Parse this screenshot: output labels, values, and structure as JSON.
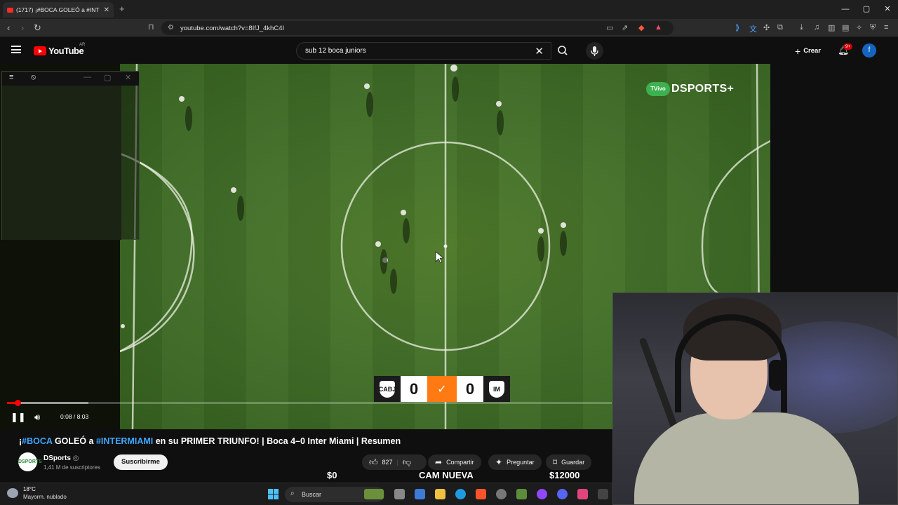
{
  "browser": {
    "tab_title": "(1717) ¡#BOCA GOLEÓ a #INT",
    "tab_close": "✕",
    "new_tab": "+",
    "url": "youtube.com/watch?v=8IfJ_4khC4I",
    "window_controls": [
      "—",
      "▢",
      "✕"
    ]
  },
  "youtube": {
    "logo_text": "YouTube",
    "country_code": "AR",
    "search_query": "sub 12 boca juniors",
    "clear_search": "✕",
    "create_label": "Crear",
    "notifications_badge": "9+",
    "account_initial": "f"
  },
  "video": {
    "broadcaster": "DSPORTS+",
    "live_badge": "TVivo",
    "score_home": "0",
    "score_away": "0",
    "home_crest": "CABJ",
    "away_crest": "IM",
    "time_current": "0:08",
    "time_total": "8:03",
    "timecode": "0:08 / 8:03",
    "played_fraction": 0.017,
    "buffered_fraction": 0.134
  },
  "details": {
    "title_prefix": "¡",
    "tag1": "#BOCA",
    "title_mid": " GOLEÓ a ",
    "tag2": "#INTERMIAMI",
    "title_rest": " en su PRIMER TRIUNFO! | Boca 4–0 Inter Miami | Resumen",
    "channel_name": "DSports",
    "channel_verified": "◎",
    "subscribers": "1,41 M de suscriptores",
    "subscribe_label": "Suscribirme",
    "likes": "827",
    "share_label": "Compartir",
    "ask_label": "Preguntar",
    "save_label": "Guardar",
    "avatar_text": "DSPORTS"
  },
  "stream_overlay": {
    "left_amount": "$0",
    "center_text": "CAM NUEVA",
    "right_amount": "$12000"
  },
  "taskbar": {
    "temperature": "18°C",
    "weather": "Mayorm. nublado",
    "search_label": "Buscar"
  },
  "colors": {
    "youtube_red": "#ff0000",
    "link_blue": "#3ea6ff",
    "scoreboard_orange": "#ff7a12",
    "dsports_green": "#3db04f"
  }
}
